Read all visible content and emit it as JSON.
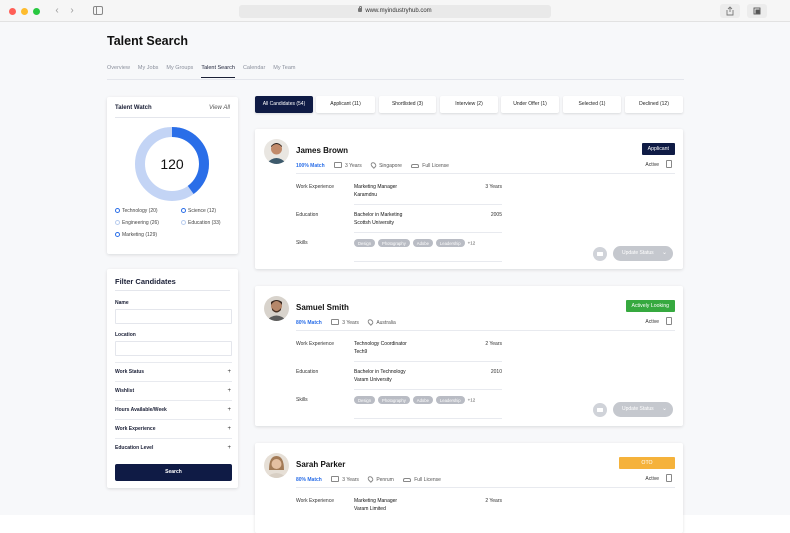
{
  "browser": {
    "url": "www.myindustryhub.com",
    "colors": {
      "close": "#ff5f57",
      "minimize": "#febc2e",
      "zoom": "#28c840"
    }
  },
  "page": {
    "title": "Talent Search",
    "tabs": [
      "Overview",
      "My Jobs",
      "My Groups",
      "Talent Search",
      "Calendar",
      "My Team"
    ],
    "active_tab": "Talent Search"
  },
  "talent_watch": {
    "title": "Talent Watch",
    "view_all": "View All",
    "total": "120",
    "legend": [
      {
        "label": "Technology (20)",
        "emphasis": true
      },
      {
        "label": "Science (12)",
        "emphasis": true
      },
      {
        "label": "Engineering (26)",
        "emphasis": false
      },
      {
        "label": "Education (33)",
        "emphasis": false
      },
      {
        "label": "Marketing (129)",
        "emphasis": true
      }
    ],
    "donut": {
      "highlight_fraction": 0.4,
      "highlight_color": "#2a6ee8",
      "base_color": "#c3d4f5"
    }
  },
  "filter": {
    "title": "Filter Candidates",
    "name_label": "Name",
    "location_label": "Location",
    "rows": [
      "Work Status",
      "Wishlist",
      "Hours Available/Week",
      "Work Experience",
      "Education Level"
    ],
    "search_label": "Search"
  },
  "status_tabs": [
    {
      "label": "All Candidates (54)",
      "active": true
    },
    {
      "label": "Applicant (11)",
      "active": false
    },
    {
      "label": "Shortlisted (3)",
      "active": false
    },
    {
      "label": "Interview (2)",
      "active": false
    },
    {
      "label": "Under Offer (1)",
      "active": false
    },
    {
      "label": "Selected (1)",
      "active": false
    },
    {
      "label": "Declined (12)",
      "active": false
    }
  ],
  "labels": {
    "work_experience": "Work Experience",
    "education": "Education",
    "skills": "Skills",
    "active": "Active",
    "update_status": "Update Status"
  },
  "candidates": [
    {
      "name": "James Brown",
      "badge": "Applicant",
      "badge_bg": "#0f1b45",
      "badge_fg": "#ffffff",
      "match": "100% Match",
      "years": "3 Years",
      "location": "Singapore",
      "license": "Full License",
      "job_title": "Marketing Manager",
      "job_company": "Karamdnu",
      "job_years": "3 Years",
      "degree": "Bachelor in Marketing",
      "school": "Scottsh University",
      "edu_year": "2005",
      "skills": [
        "Design",
        "Photography",
        "Adobe",
        "Leadership"
      ],
      "more_skills": "+12"
    },
    {
      "name": "Samuel Smith",
      "badge": "Actively Looking",
      "badge_bg": "#36a93f",
      "badge_fg": "#ffffff",
      "match": "80% Match",
      "years": "3 Years",
      "location": "Australia",
      "license": "",
      "job_title": "Technology Coordinator",
      "job_company": "Tech9",
      "job_years": "2 Years",
      "degree": "Bachelor in Technology",
      "school": "Varam University",
      "edu_year": "2010",
      "skills": [
        "Design",
        "Photography",
        "Adobe",
        "Leadership"
      ],
      "more_skills": "+12"
    },
    {
      "name": "Sarah Parker",
      "badge": "OTO",
      "badge_bg": "#f5b23b",
      "badge_fg": "#ffffff",
      "match": "80% Match",
      "years": "3 Years",
      "location": "Penrum",
      "license": "Full License",
      "job_title": "Marketing Manager",
      "job_company": "Varam Limited",
      "job_years": "2 Years"
    }
  ]
}
